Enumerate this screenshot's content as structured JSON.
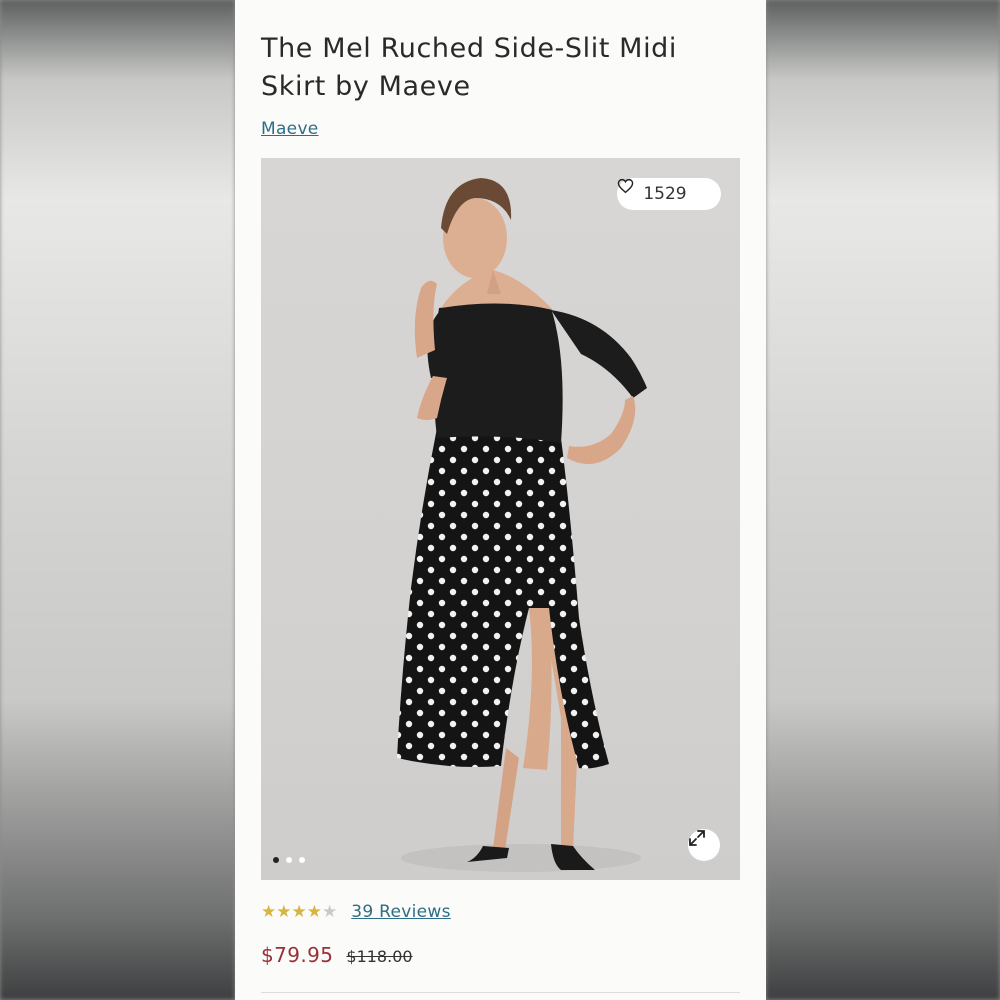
{
  "product": {
    "title": "The Mel Ruched Side-Slit Midi Skirt by Maeve",
    "brand": "Maeve"
  },
  "gallery": {
    "favorites_count": "1529",
    "favorite_icon": "heart-icon",
    "expand_icon": "expand-arrows-icon",
    "slide_count": 3,
    "active_slide": 1
  },
  "reviews": {
    "rating": 4,
    "max_rating": 5,
    "label": "39 Reviews"
  },
  "pricing": {
    "sale_price": "$79.95",
    "original_price": "$118.00"
  },
  "colors": {
    "link": "#2f6d86",
    "sale_price": "#9a2f3a",
    "star_filled": "#d8b541",
    "star_empty": "#c9c9c9"
  }
}
